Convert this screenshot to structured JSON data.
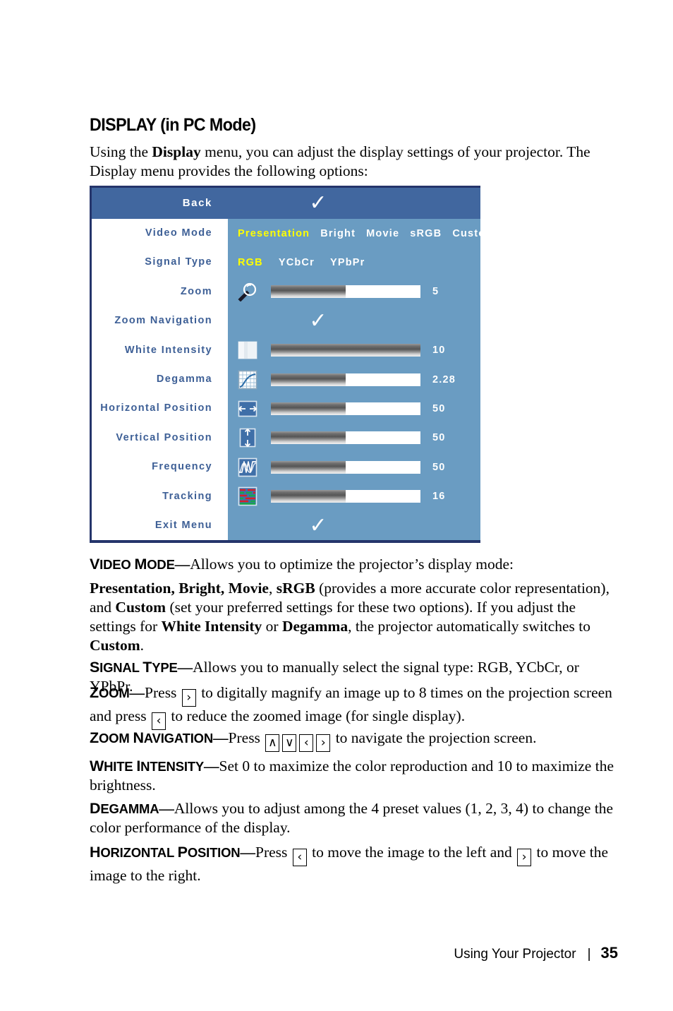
{
  "heading": "DISPLAY (in PC Mode)",
  "intro": {
    "part1": "Using the ",
    "bold1": "Display",
    "part2": " menu, you can adjust the display settings of your projector. The Display menu provides the following options:"
  },
  "osd": {
    "header": {
      "label": "Back",
      "check": "✓"
    },
    "rows": [
      {
        "label": "Video Mode",
        "type": "options",
        "options": [
          {
            "text": "Presentation",
            "selected": true
          },
          {
            "text": "Bright",
            "selected": false
          },
          {
            "text": "Movie",
            "selected": false
          },
          {
            "text": "sRGB",
            "selected": false
          },
          {
            "text": "Custom",
            "selected": false
          }
        ]
      },
      {
        "label": "Signal Type",
        "type": "options",
        "options": [
          {
            "text": "RGB",
            "selected": true
          },
          {
            "text": "YCbCr",
            "selected": false
          },
          {
            "text": "YPbPr",
            "selected": false
          }
        ]
      },
      {
        "label": "Zoom",
        "type": "slider",
        "icon": "magnifier-icon",
        "value": "5",
        "fill_percent": 50
      },
      {
        "label": "Zoom Navigation",
        "type": "check",
        "check": "✓"
      },
      {
        "label": "White Intensity",
        "type": "slider",
        "icon": "white-intensity-icon",
        "value": "10",
        "fill_percent": 100
      },
      {
        "label": "Degamma",
        "type": "slider",
        "icon": "degamma-curve-icon",
        "value": "2.28",
        "fill_percent": 50
      },
      {
        "label": "Horizontal Position",
        "type": "slider",
        "icon": "horizontal-arrows-icon",
        "value": "50",
        "fill_percent": 50
      },
      {
        "label": "Vertical Position",
        "type": "slider",
        "icon": "vertical-arrows-icon",
        "value": "50",
        "fill_percent": 50
      },
      {
        "label": "Frequency",
        "type": "slider",
        "icon": "waveform-icon",
        "value": "50",
        "fill_percent": 50
      },
      {
        "label": "Tracking",
        "type": "slider",
        "icon": "tracking-stripes-icon",
        "value": "16",
        "fill_percent": 50
      },
      {
        "label": "Exit Menu",
        "type": "check",
        "check": "✓"
      }
    ],
    "colors": {
      "header_blue": "#41679f",
      "body_blue": "#6a9cc2",
      "border_navy": "#25356b",
      "label_blue": "#3d5f96",
      "selected_yellow": "#ffff00",
      "label_bg": "#ffffff"
    }
  },
  "sections": {
    "video_mode": {
      "term_small": "IDEO ",
      "term_cap1": "V",
      "term_cap2": "M",
      "term_small2": "ODE",
      "dash": "—",
      "text": "Allows you to optimize the projector’s display mode:"
    },
    "video_mode_body": {
      "b1": "Presentation, Bright, Movie",
      "t1": ", ",
      "b2": "sRGB",
      "t2": " (provides a more accurate color representation), and ",
      "b3": "Custom",
      "t3": " (set your preferred settings for these two options). If you adjust the settings for ",
      "b4": "White Intensity",
      "t4": " or ",
      "b5": "Degamma",
      "t5": ", the projector automatically switches to ",
      "b6": "Custom",
      "t6": "."
    },
    "signal_type": {
      "cap1": "S",
      "small1": "IGNAL ",
      "cap2": "T",
      "small2": "YPE",
      "dash": "—",
      "text": "Allows you to manually select the signal type: RGB, YCbCr, or YPbPr."
    },
    "zoom": {
      "cap1": "Z",
      "small1": "OOM",
      "dash": "—",
      "t1": "Press ",
      "key1": "›",
      "t2": " to digitally magnify an image up to 8 times on the projection screen and press ",
      "key2": "‹",
      "t3": " to reduce the zoomed image (for single display)."
    },
    "zoom_navigation": {
      "cap1": "Z",
      "small1": "OOM ",
      "cap2": "N",
      "small2": "AVIGATION",
      "dash": "—",
      "t1": "Press ",
      "key_up": "∧",
      "key_down": "∨",
      "key_left": "‹",
      "key_right": "›",
      "t2": " to navigate the projection screen."
    },
    "white_intensity": {
      "cap1": "W",
      "small1": "HITE ",
      "cap2": "I",
      "small2": "NTENSITY",
      "dash": "—",
      "text": "Set 0 to maximize the color reproduction and 10 to maximize the brightness."
    },
    "degamma": {
      "cap1": "D",
      "small1": "EGAMMA",
      "dash": "—",
      "text": "Allows you to adjust among the 4 preset values (1, 2, 3, 4) to change the color performance of the display."
    },
    "horizontal_position": {
      "cap1": "H",
      "small1": "ORIZONTAL ",
      "cap2": "P",
      "small2": "OSITION",
      "dash": "—",
      "t1": "Press ",
      "key1": "‹",
      "t2": " to move the image to the left and ",
      "key2": "›",
      "t3": " to move the image to the right."
    }
  },
  "footer": {
    "text": "Using Your Projector",
    "separator": "|",
    "page_number": "35"
  }
}
